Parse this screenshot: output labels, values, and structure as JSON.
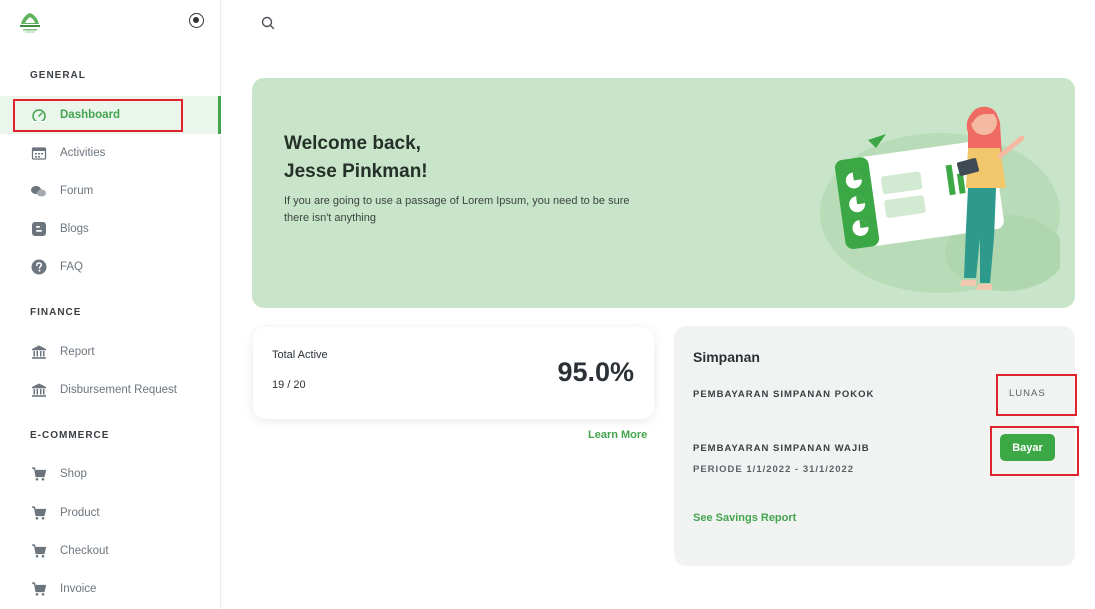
{
  "sidebar": {
    "sections": {
      "general": "GENERAL",
      "finance": "FINANCE",
      "ecommerce": "E-COMMERCE"
    },
    "items": {
      "dashboard": {
        "label": "Dashboard",
        "icon": "dashboard-gauge-icon"
      },
      "activities": {
        "label": "Activities",
        "icon": "calendar-icon"
      },
      "forum": {
        "label": "Forum",
        "icon": "chat-bubbles-icon"
      },
      "blogs": {
        "label": "Blogs",
        "icon": "blogger-icon"
      },
      "faq": {
        "label": "FAQ",
        "icon": "question-circle-icon"
      },
      "report": {
        "label": "Report",
        "icon": "bank-icon"
      },
      "disbursement": {
        "label": "Disbursement Request",
        "icon": "bank-icon"
      },
      "shop": {
        "label": "Shop",
        "icon": "cart-icon"
      },
      "product": {
        "label": "Product",
        "icon": "cart-icon"
      },
      "checkout": {
        "label": "Checkout",
        "icon": "cart-icon"
      },
      "invoice": {
        "label": "Invoice",
        "icon": "cart-icon"
      }
    }
  },
  "welcome": {
    "line1": "Welcome back,",
    "line2": "Jesse Pinkman!",
    "text": "If you are going to use a passage of Lorem Ipsum, you need to be sure there isn't anything"
  },
  "total_active": {
    "title": "Total Active",
    "count": "19 / 20",
    "percent": "95.0%",
    "learn_more": "Learn More"
  },
  "simpanan": {
    "title": "Simpanan",
    "pokok_label": "PEMBAYARAN SIMPANAN POKOK",
    "pokok_status": "LUNAS",
    "wajib_label": "PEMBAYARAN SIMPANAN WAJIB",
    "wajib_period": "PERIODE 1/1/2022 - 31/1/2022",
    "pay_button": "Bayar",
    "report_link": "See Savings Report"
  },
  "colors": {
    "accent": "#43a54d",
    "hero_bg": "#c9e5c9",
    "highlight": "#e0222b"
  }
}
